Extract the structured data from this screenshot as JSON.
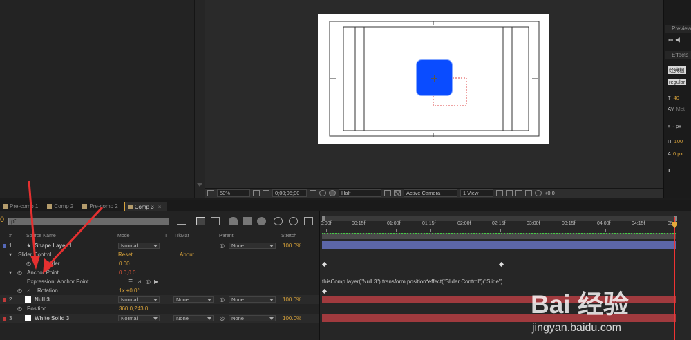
{
  "viewer": {
    "zoom": "50%",
    "timecode": "0;00;05;00",
    "resolution": "Half",
    "camera": "Active Camera",
    "views": "1 View",
    "exposure": "+0.0"
  },
  "right_panels": {
    "preview_title": "Preview",
    "effects_title": "Effects",
    "font_name": "经典粗",
    "font_style": "regular",
    "size_value": "40",
    "metrics": "Met",
    "px_label_1": "- px",
    "scale_value": "100",
    "px_label_2": "0 px",
    "t_label": "T"
  },
  "tabs": [
    {
      "label": "Pre-comp 1",
      "color": "#b39b6b",
      "active": false
    },
    {
      "label": "Comp 2",
      "color": "#b39b6b",
      "active": false
    },
    {
      "label": "Pre-comp 2",
      "color": "#b39b6b",
      "active": false
    },
    {
      "label": "Comp 3",
      "color": "#b39b6b",
      "active": true
    }
  ],
  "timeline": {
    "search_placeholder": "ρ˜",
    "columns": {
      "hash": "#",
      "source_name": "Source Name",
      "mode": "Mode",
      "t": "T",
      "trkmat": "TrkMat",
      "parent": "Parent",
      "stretch": "Stretch"
    },
    "rows": {
      "l1": {
        "num": "1",
        "name": "Shape Layer 1",
        "mode": "Normal",
        "parent": "None",
        "stretch": "100.0%",
        "color": "#5568b8"
      },
      "slider_control": {
        "name": "Slider Control",
        "reset": "Reset",
        "about": "About..."
      },
      "slider": {
        "name": "Slider",
        "value": "0.00"
      },
      "anchor": {
        "name": "Anchor Point",
        "value": "0.0,0.0"
      },
      "expression": {
        "name": "Expression: Anchor Point",
        "code": "thisComp.layer(\"Null 3\").transform.position*effect(\"Slider Control\")(\"Slide\")"
      },
      "rotation": {
        "name": "Rotation",
        "value": "1x +0.0°"
      },
      "l2": {
        "num": "2",
        "name": "Null 3",
        "mode": "Normal",
        "trkmat": "None",
        "parent": "None",
        "stretch": "100.0%",
        "color": "#c03a3a"
      },
      "position": {
        "name": "Position",
        "value": "360.0,243.0"
      },
      "l3": {
        "num": "3",
        "name": "White Solid 3",
        "mode": "Normal",
        "trkmat": "None",
        "parent": "None",
        "stretch": "100.0%",
        "color": "#c03a3a"
      }
    },
    "ruler": [
      "0:00f",
      "00:15f",
      "01:00f",
      "01:15f",
      "02:00f",
      "02:15f",
      "03:00f",
      "03:15f",
      "04:00f",
      "04:15f",
      "05:0"
    ]
  },
  "watermark": {
    "main": "Bai 经验",
    "sub": "jingyan.baidu.com"
  }
}
